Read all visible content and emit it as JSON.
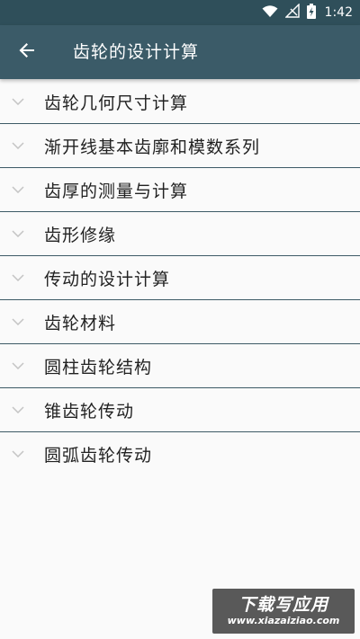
{
  "status_bar": {
    "time": "1:42",
    "icons": [
      "wifi-icon",
      "no-signal-icon",
      "battery-charging-icon"
    ]
  },
  "app_bar": {
    "back_icon": "arrow-left-icon",
    "title": "齿轮的设计计算"
  },
  "list": {
    "items": [
      {
        "label": "齿轮几何尺寸计算",
        "icon": "chevron-down-icon"
      },
      {
        "label": "渐开线基本齿廓和模数系列",
        "icon": "chevron-down-icon"
      },
      {
        "label": "齿厚的测量与计算",
        "icon": "chevron-down-icon"
      },
      {
        "label": "齿形修缘",
        "icon": "chevron-down-icon"
      },
      {
        "label": "传动的设计计算",
        "icon": "chevron-down-icon"
      },
      {
        "label": "齿轮材料",
        "icon": "chevron-down-icon"
      },
      {
        "label": "圆柱齿轮结构",
        "icon": "chevron-down-icon"
      },
      {
        "label": "锥齿轮传动",
        "icon": "chevron-down-icon"
      },
      {
        "label": "圆弧齿轮传动",
        "icon": "chevron-down-icon"
      }
    ]
  },
  "watermark": {
    "title": "下载写应用",
    "url": "www.xiazaiziao.com"
  },
  "colors": {
    "app_bar": "#3b5b68",
    "status_bar": "#2f4f5a",
    "divider": "#3d5a66",
    "background": "#fafafa",
    "text": "#222222",
    "chevron": "#c4c4c4"
  }
}
